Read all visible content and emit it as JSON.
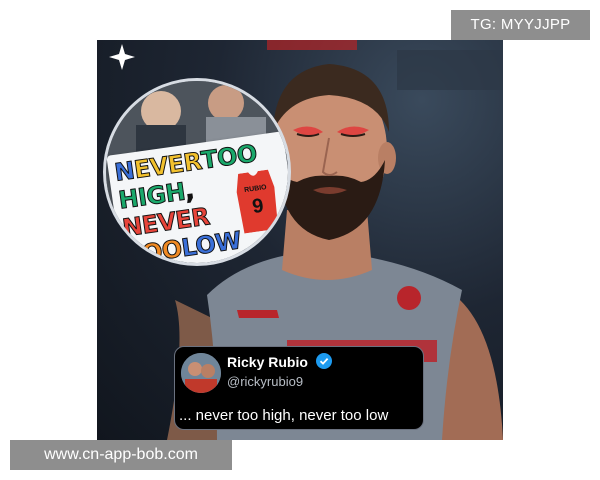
{
  "watermarks": {
    "top": "TG: MYYJJPP",
    "bottom": "www.cn-app-bob.com"
  },
  "photo": {
    "sign_lines": [
      [
        "N",
        "EVER",
        " ",
        "TOO"
      ],
      [
        "HIGH",
        ","
      ],
      [
        "NEVER"
      ],
      [
        "TOO",
        " ",
        "LOW"
      ]
    ],
    "jersey_name": "RUBIO",
    "jersey_number": "9"
  },
  "tweet": {
    "name": "Ricky Rubio",
    "handle": "@rickyrubio9",
    "text": "... never too high, never too low",
    "verified_color": "#1d9bf0"
  },
  "colors": {
    "jersey": "#7d8794",
    "skin": "#c98f73",
    "beard": "#2a1b14"
  }
}
